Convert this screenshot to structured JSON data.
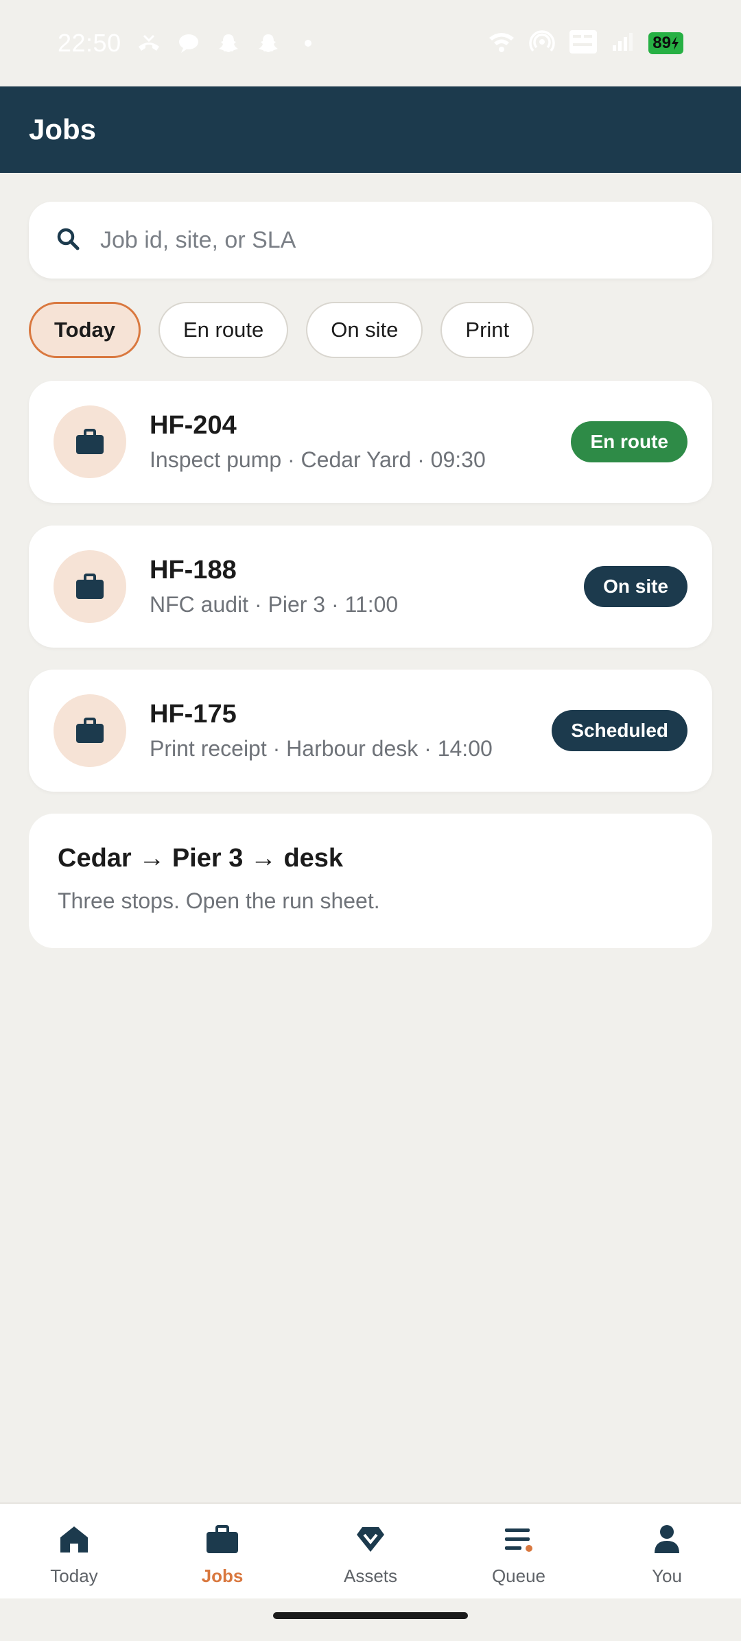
{
  "status_bar": {
    "time": "22:50",
    "battery": "89"
  },
  "app_bar": {
    "title": "Jobs"
  },
  "search": {
    "placeholder": "Job id, site, or SLA"
  },
  "filters": [
    "Today",
    "En route",
    "On site",
    "Print"
  ],
  "jobs": [
    {
      "id": "HF-204",
      "details": "Inspect pump · Cedar Yard · 09:30",
      "status": "En route",
      "status_color": "#2e8b47"
    },
    {
      "id": "HF-188",
      "details": "NFC audit · Pier 3 · 11:00",
      "status": "On site",
      "status_color": "#1c3a4d"
    },
    {
      "id": "HF-175",
      "details": "Print receipt · Harbour desk · 14:00",
      "status": "Scheduled",
      "status_color": "#1c3a4d"
    }
  ],
  "route": {
    "title": "Cedar → Pier 3 → desk",
    "subtitle": "Three stops. Open the run sheet."
  },
  "bottom_nav": [
    {
      "label": "Today",
      "icon": "home-icon"
    },
    {
      "label": "Jobs",
      "icon": "briefcase-icon"
    },
    {
      "label": "Assets",
      "icon": "diamond-icon"
    },
    {
      "label": "Queue",
      "icon": "queue-icon"
    },
    {
      "label": "You",
      "icon": "person-icon"
    }
  ],
  "colors": {
    "primary": "#1c3a4d",
    "accent": "#d9783f",
    "background": "#f1f0ec",
    "chip_active_bg": "#f6e3d6",
    "en_route": "#2e8b47"
  }
}
